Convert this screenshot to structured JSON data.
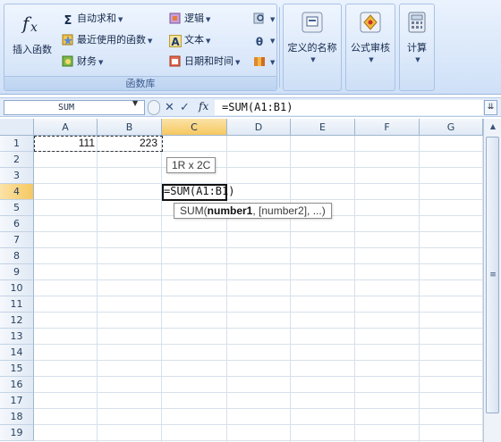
{
  "ribbon": {
    "insert_function": {
      "label": "插入函数",
      "icon": "fx-icon"
    },
    "autosum": {
      "label": "自动求和",
      "icon": "sigma-icon"
    },
    "recent": {
      "label": "最近使用的函数",
      "icon": "star-book-icon"
    },
    "financial": {
      "label": "财务",
      "icon": "money-book-icon"
    },
    "logical": {
      "label": "逻辑",
      "icon": "logic-book-icon"
    },
    "text": {
      "label": "文本",
      "icon": "text-book-icon"
    },
    "datetime": {
      "label": "日期和时间",
      "icon": "calendar-book-icon"
    },
    "group_label": "函数库",
    "defined_names": {
      "label": "定义的名称",
      "icon": "names-icon"
    },
    "formula_auditing": {
      "label": "公式审核",
      "icon": "audit-icon"
    },
    "calculation": {
      "label": "计算",
      "icon": "calculator-icon"
    }
  },
  "formula_bar": {
    "name_box": "SUM",
    "cancel": "✕",
    "enter": "✓",
    "fx": "fx",
    "formula": "=SUM(A1:B1)"
  },
  "sheet": {
    "columns": [
      "A",
      "B",
      "C",
      "D",
      "E",
      "F",
      "G"
    ],
    "rows": [
      "1",
      "2",
      "3",
      "4",
      "5",
      "6",
      "7",
      "8",
      "9",
      "10",
      "11",
      "12",
      "13",
      "14",
      "15",
      "16",
      "17",
      "18",
      "19"
    ],
    "selected_column": "C",
    "selected_row": "4",
    "cells": {
      "A1": "111",
      "B1": "223",
      "C4": "=SUM(A1:B1)"
    },
    "selection_size_tip": "1R x 2C",
    "function_tip": {
      "name": "SUM(",
      "arg1": "number1",
      "rest": ", [number2], ...)"
    }
  },
  "colors": {
    "accent": "#f6c860",
    "ribbon": "#d7e6f9",
    "header": "#e0e9f5"
  }
}
